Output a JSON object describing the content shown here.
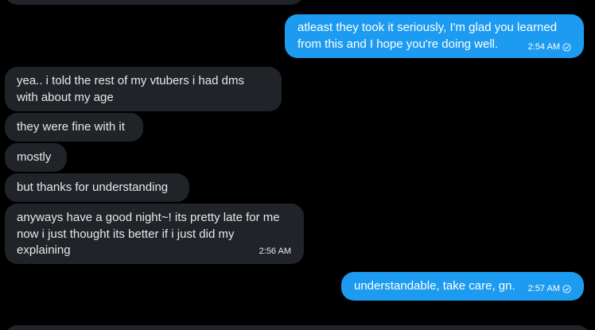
{
  "conversation": {
    "messages": [
      {
        "id": "m1",
        "direction": "outgoing",
        "text": "atleast they took it seriously, I'm glad you learned from this and I hope you're doing well.",
        "time": "2:54 AM",
        "status_icon": "check-circle-icon"
      },
      {
        "id": "m2",
        "direction": "incoming",
        "text": "yea.. i told the rest of my vtubers i had dms with about my age"
      },
      {
        "id": "m3",
        "direction": "incoming",
        "text": "they were fine with it"
      },
      {
        "id": "m4",
        "direction": "incoming",
        "text": "mostly"
      },
      {
        "id": "m5",
        "direction": "incoming",
        "text": "but thanks for understanding"
      },
      {
        "id": "m6",
        "direction": "incoming",
        "text": "anyways have a good night~! its pretty late for me now i just thought its better if i just did my explaining",
        "time": "2:56 AM"
      },
      {
        "id": "m7",
        "direction": "outgoing",
        "text": "understandable, take care, gn.",
        "time": "2:57 AM",
        "status_icon": "check-circle-icon"
      }
    ]
  },
  "colors": {
    "background": "#000000",
    "incoming_bubble": "#202327",
    "outgoing_bubble": "#1d9bf0",
    "text": "#e7e9ea"
  }
}
